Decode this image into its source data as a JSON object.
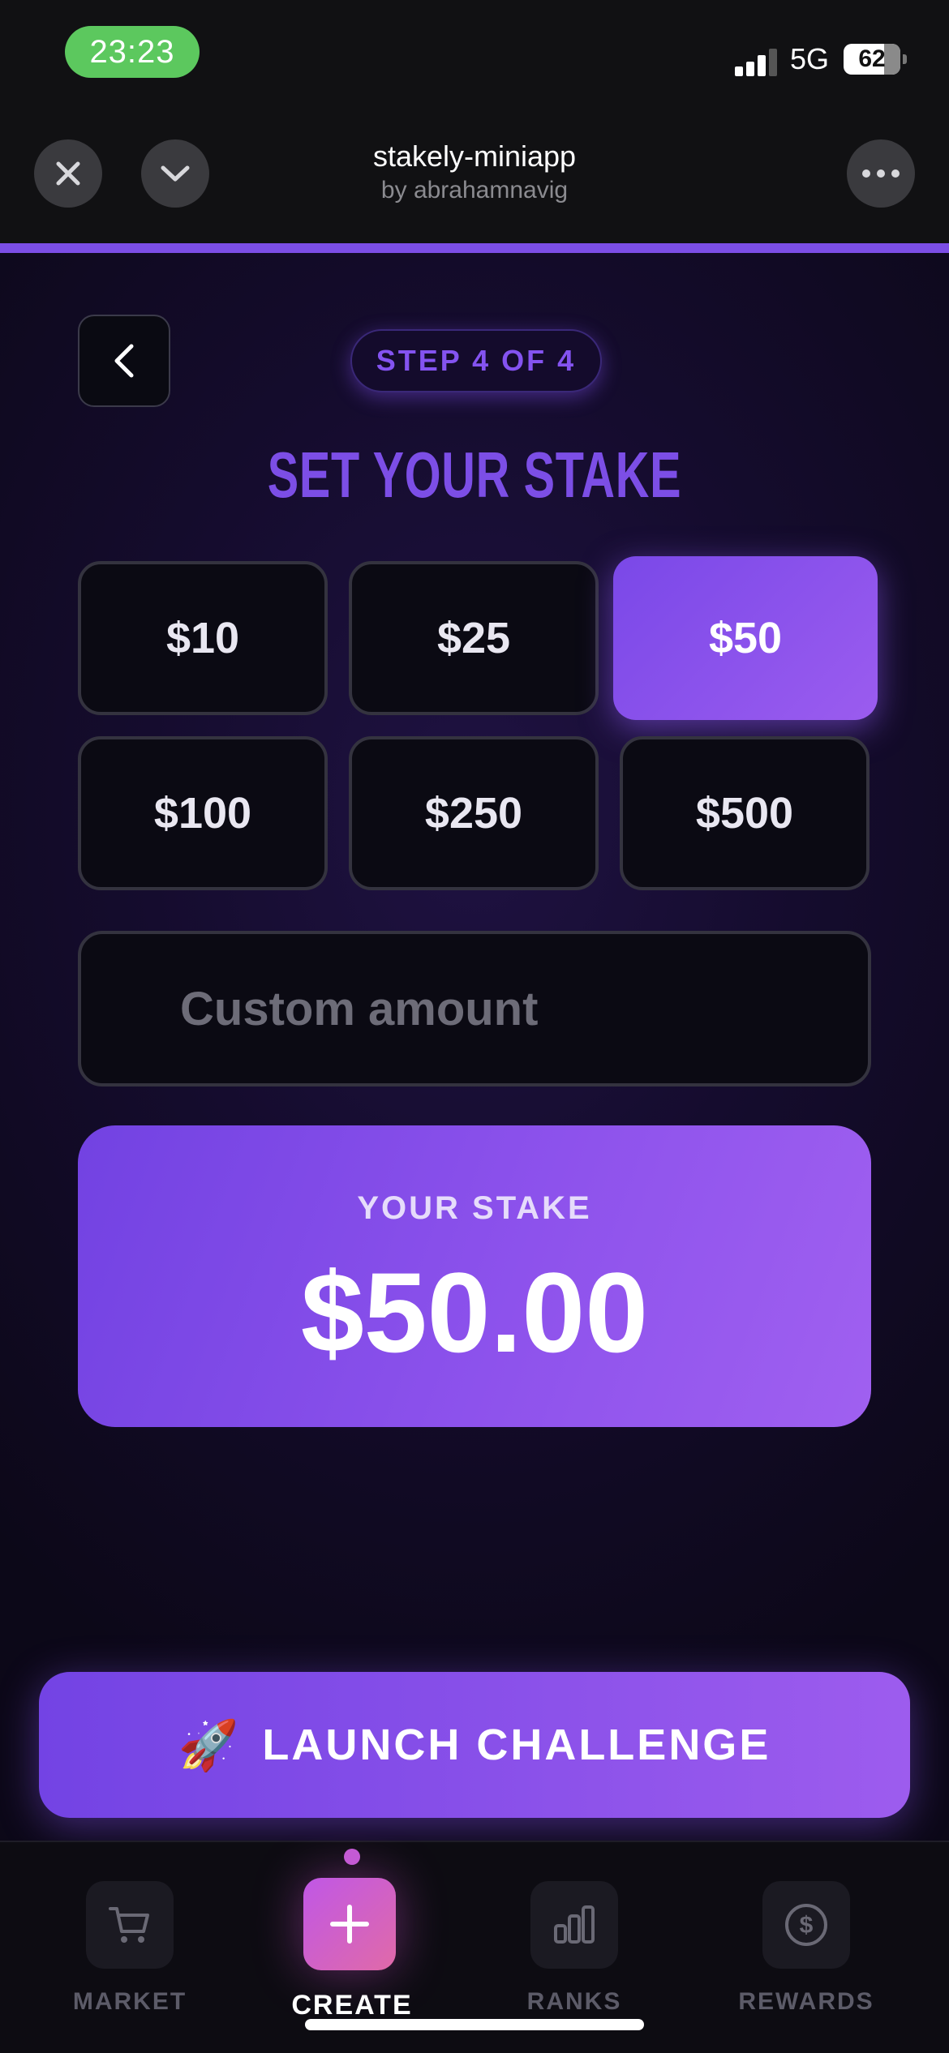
{
  "status_bar": {
    "time": "23:23",
    "network": "5G",
    "battery": "62"
  },
  "header": {
    "title": "stakely-miniapp",
    "subtitle": "by abrahamnavig"
  },
  "step": {
    "label": "STEP 4 OF 4"
  },
  "page_title": "SET YOUR STAKE",
  "amounts": [
    {
      "label": "$10",
      "selected": false
    },
    {
      "label": "$25",
      "selected": false
    },
    {
      "label": "$50",
      "selected": true
    },
    {
      "label": "$100",
      "selected": false
    },
    {
      "label": "$250",
      "selected": false
    },
    {
      "label": "$500",
      "selected": false
    }
  ],
  "custom_amount": {
    "placeholder": "Custom amount",
    "value": ""
  },
  "stake": {
    "label": "YOUR STAKE",
    "value": "$50.00"
  },
  "launch": {
    "icon": "rocket-icon",
    "label": "LAUNCH CHALLENGE"
  },
  "tabs": [
    {
      "label": "MARKET",
      "icon": "cart-icon",
      "active": false
    },
    {
      "label": "CREATE",
      "icon": "plus-icon",
      "active": true
    },
    {
      "label": "RANKS",
      "icon": "bar-chart-icon",
      "active": false
    },
    {
      "label": "REWARDS",
      "icon": "dollar-coin-icon",
      "active": false
    }
  ],
  "colors": {
    "accent": "#7c4ee6",
    "accent_light": "#9b5cef",
    "create_tab": "#d061c8",
    "status_green": "#5cc85e"
  }
}
